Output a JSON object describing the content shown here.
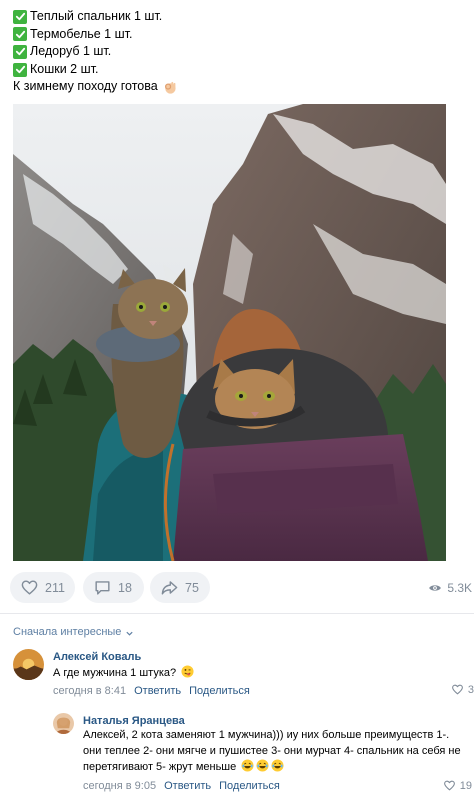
{
  "post": {
    "lines": [
      "Теплый спальник 1 шт.",
      "Термобелье 1 шт.",
      "Ледоруб 1 шт.",
      "Кошки 2 шт."
    ],
    "closing": "К зимнему походу готова",
    "closing_emoji": "ok-hand-emoji"
  },
  "photo": {
    "icon": "mountain-cats-photo"
  },
  "actions": {
    "likes": "211",
    "comments": "18",
    "shares": "75",
    "views": "5.3K"
  },
  "comments_section": {
    "sort_label": "Сначала интересные",
    "items": [
      {
        "author": "Алексей Коваль",
        "text": "А где мужчина 1 штука?",
        "emoji": "tongue-wink-emoji",
        "time": "сегодня в 8:41",
        "reply_label": "Ответить",
        "share_label": "Поделиться",
        "likes": "3"
      },
      {
        "author": "Наталья Яранцева",
        "text": "Алексей, 2 кота заменяют 1 мужчина))) иу них больше преимуществ 1-. они теплее 2- они мягче и пушистее 3- они мурчат 4- спальник на себя не перетягивают 5- жрут меньше",
        "emoji": "laughing-tears-emoji",
        "time": "сегодня в 9:05",
        "reply_label": "Ответить",
        "share_label": "Поделиться",
        "likes": "19"
      }
    ]
  },
  "colors": {
    "link": "#2a5885",
    "muted": "#818c99",
    "pill_bg": "#f0f2f5",
    "check_green": "#3fb33f"
  }
}
